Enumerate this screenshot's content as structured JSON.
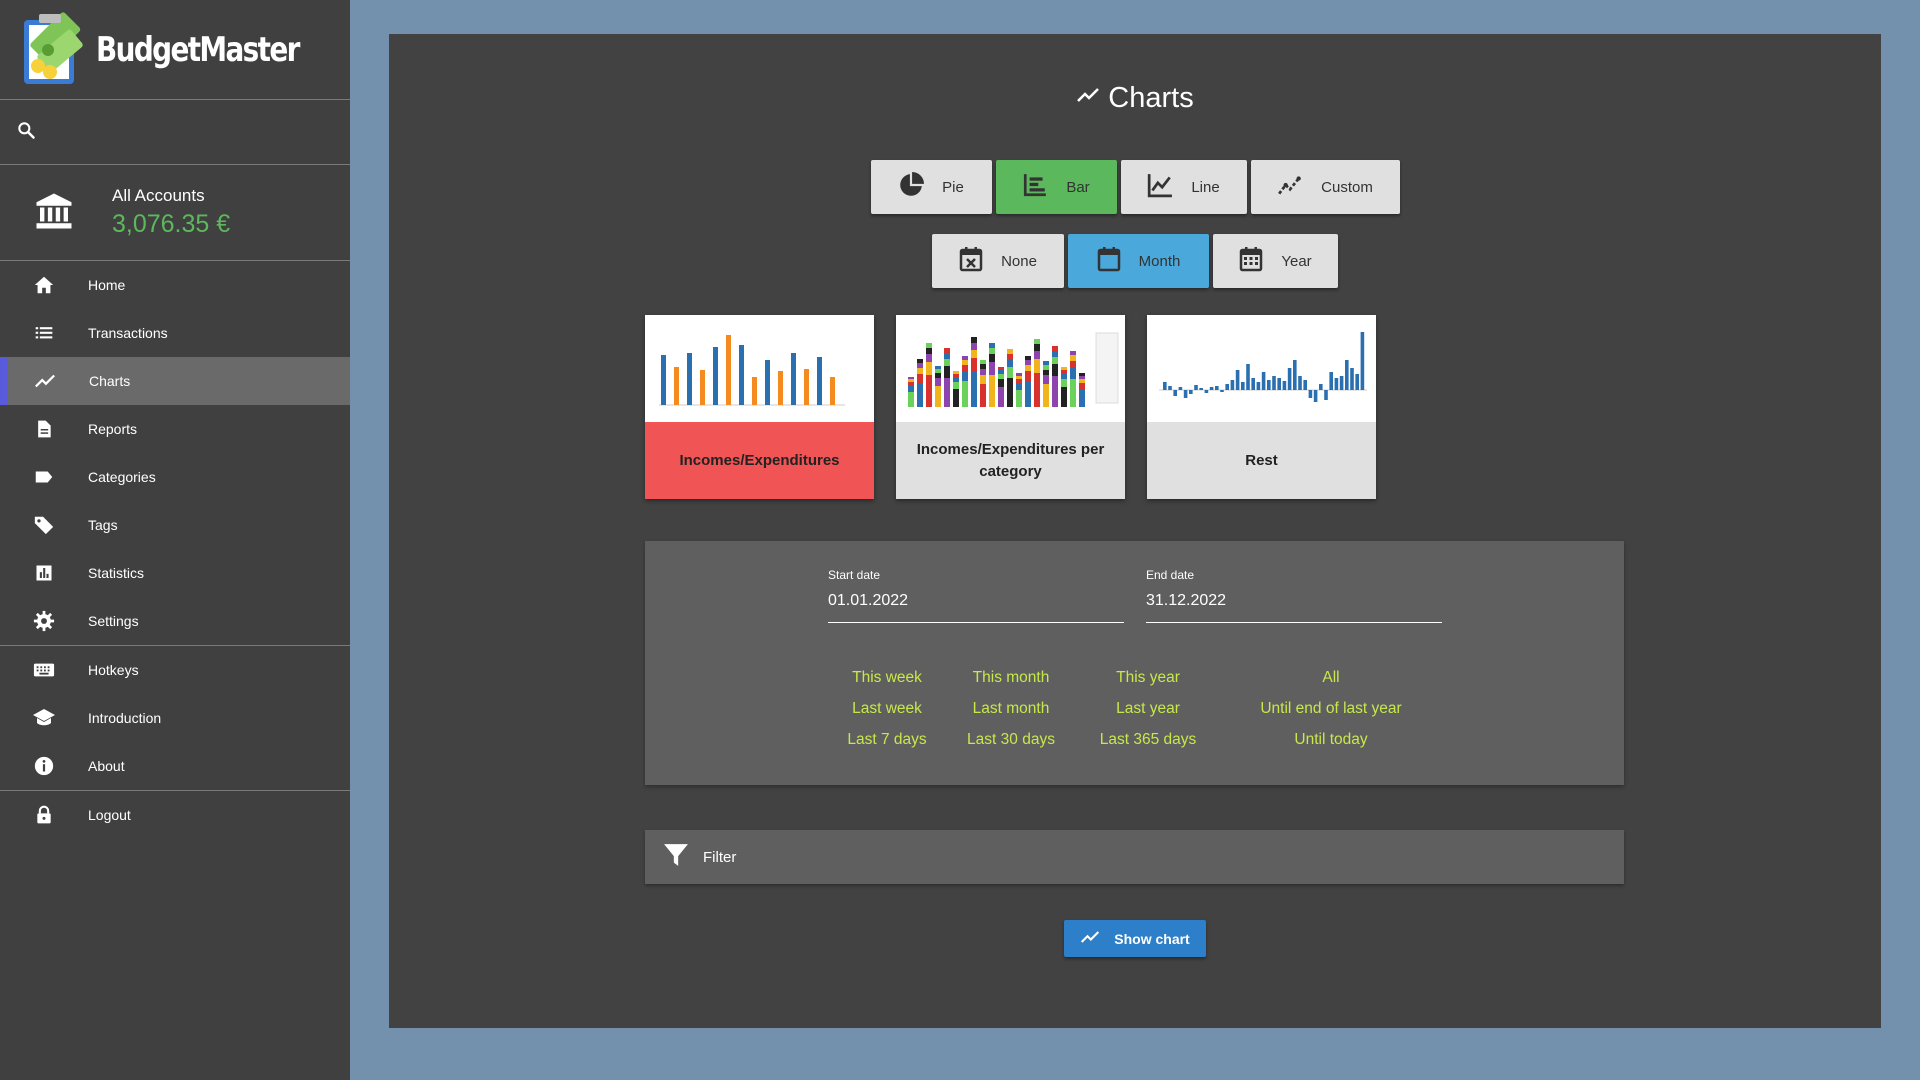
{
  "app": {
    "name": "BudgetMaster"
  },
  "account": {
    "name": "All Accounts",
    "amount": "3,076.35 €"
  },
  "nav": [
    {
      "label": "Home",
      "icon": "home-icon"
    },
    {
      "label": "Transactions",
      "icon": "list-icon"
    },
    {
      "label": "Charts",
      "icon": "chart-line-icon",
      "active": true
    },
    {
      "label": "Reports",
      "icon": "document-icon"
    },
    {
      "label": "Categories",
      "icon": "label-icon"
    },
    {
      "label": "Tags",
      "icon": "tag-icon"
    },
    {
      "label": "Statistics",
      "icon": "bar-stats-icon"
    },
    {
      "label": "Settings",
      "icon": "gear-icon"
    },
    {
      "label": "Hotkeys",
      "icon": "keyboard-icon"
    },
    {
      "label": "Introduction",
      "icon": "graduation-cap-icon"
    },
    {
      "label": "About",
      "icon": "info-icon"
    },
    {
      "label": "Logout",
      "icon": "lock-icon"
    }
  ],
  "page": {
    "title": "Charts"
  },
  "chart_types": [
    {
      "label": "Pie",
      "icon": "pie-icon"
    },
    {
      "label": "Bar",
      "icon": "bar-chart-icon",
      "selected": true
    },
    {
      "label": "Line",
      "icon": "line-chart-icon"
    },
    {
      "label": "Custom",
      "icon": "custom-chart-icon"
    }
  ],
  "groupings": [
    {
      "label": "None",
      "icon": "calendar-remove-icon"
    },
    {
      "label": "Month",
      "icon": "calendar-month-icon",
      "selected": true
    },
    {
      "label": "Year",
      "icon": "calendar-year-icon"
    }
  ],
  "charts": [
    {
      "label": "Incomes/Expenditures",
      "active": true
    },
    {
      "label": "Incomes/Expenditures per category"
    },
    {
      "label": "Rest"
    }
  ],
  "dates": {
    "start_label": "Start date",
    "start_value": "01.01.2022",
    "end_label": "End date",
    "end_value": "31.12.2022"
  },
  "quick_ranges": [
    [
      "This week",
      "Last week",
      "Last 7 days"
    ],
    [
      "This month",
      "Last month",
      "Last 30 days"
    ],
    [
      "This year",
      "Last year",
      "Last 365 days"
    ],
    [
      "All",
      "Until end of last year",
      "Until today"
    ]
  ],
  "filter": {
    "label": "Filter"
  },
  "show_chart": {
    "label": "Show chart"
  },
  "colors": {
    "accent_green": "#5cb85c",
    "accent_blue": "#4aa8db",
    "active_red": "#f05454",
    "link_yellow": "#c6e84a",
    "primary_button": "#2d7fc9"
  }
}
